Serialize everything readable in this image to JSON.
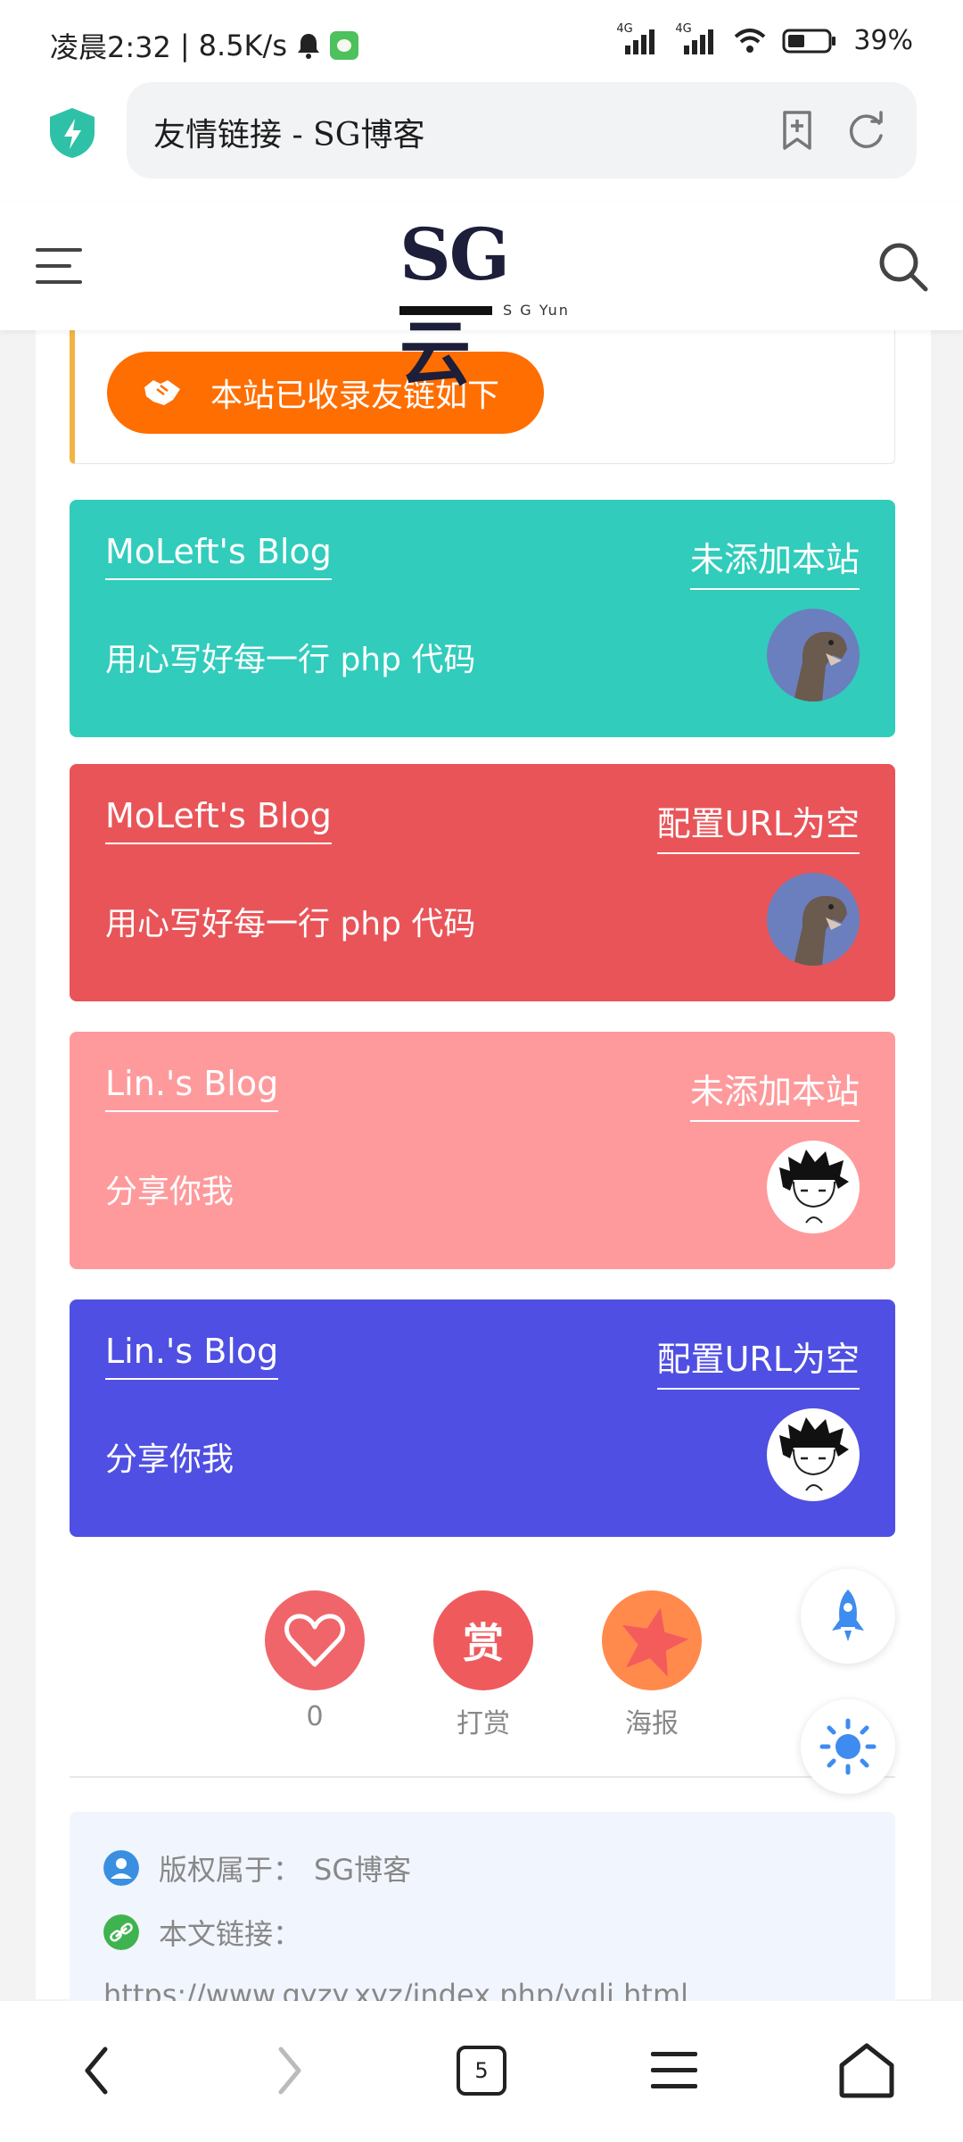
{
  "status_bar": {
    "time": "凌晨2:32",
    "speed": "8.5K/s",
    "signal1": "4G",
    "signal2": "4G",
    "battery": "39%"
  },
  "browser": {
    "page_title": "友情链接 - SG博客"
  },
  "site": {
    "logo_text": "SG云",
    "logo_sub": "S G Yun"
  },
  "notice": {
    "label": "本站已收录友链如下"
  },
  "friend_links": [
    {
      "name": "MoLeft's Blog",
      "status": "未添加本站",
      "description": "用心写好每一行 php 代码",
      "color": "#31ccbb",
      "avatar": "dinosaur"
    },
    {
      "name": "MoLeft's Blog",
      "status": "配置URL为空",
      "description": "用心写好每一行 php 代码",
      "color": "#e95458",
      "avatar": "dinosaur"
    },
    {
      "name": "Lin.'s Blog",
      "status": "未添加本站",
      "description": "分享你我",
      "color": "#fe9a9c",
      "avatar": "anime-boy"
    },
    {
      "name": "Lin.'s Blog",
      "status": "配置URL为空",
      "description": "分享你我",
      "color": "#4f4fe3",
      "avatar": "anime-boy"
    }
  ],
  "actions": {
    "like_count": "0",
    "reward_label": "打赏",
    "reward_glyph": "赏",
    "poster_label": "海报"
  },
  "copyright": {
    "owner_label": "版权属于：",
    "owner_value": "SG博客",
    "link_label": "本文链接：",
    "link_value": "https://www.gyzy.xyz/index.php/yqlj.html"
  },
  "bottom_nav": {
    "tabs_count": "5"
  }
}
